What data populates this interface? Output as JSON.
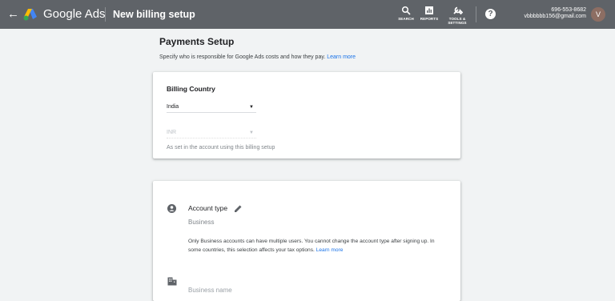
{
  "header": {
    "back_icon": "arrow-back-icon",
    "brand": "Google Ads",
    "page_title": "New billing setup",
    "tools": [
      {
        "label": "SEARCH",
        "icon": "search-icon"
      },
      {
        "label": "REPORTS",
        "icon": "reports-icon"
      },
      {
        "label1": "TOOLS &",
        "label2": "SETTINGS",
        "icon": "wrench-icon"
      }
    ],
    "help_icon": "help-icon",
    "account": {
      "phone": "696-553-8682",
      "email": "vbbbbbb156@gmail.com",
      "avatar_letter": "V"
    }
  },
  "main": {
    "title": "Payments Setup",
    "subtitle": "Specify who is responsible for Google Ads costs and how they pay.",
    "learn_more": "Learn more"
  },
  "billing_country": {
    "title": "Billing Country",
    "country": "India",
    "currency": "INR",
    "note": "As set in the account using this billing setup"
  },
  "account_section": {
    "account_type_label": "Account type",
    "account_type_value": "Business",
    "description": "Only Business accounts can have multiple users. You cannot change the account type after signing up. In some countries, this selection affects your tax options.",
    "learn_more": "Learn more",
    "business_name_placeholder": "Business name"
  },
  "colors": {
    "topbar": "#5f6368",
    "link": "#1a73e8",
    "background": "#f1f3f4"
  }
}
